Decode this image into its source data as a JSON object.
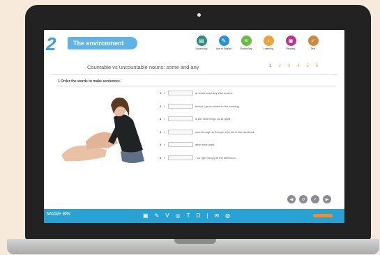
{
  "unit": {
    "number": "2",
    "title": "The environment"
  },
  "nav": [
    {
      "label": "Vocabulary",
      "icon": "book-icon",
      "color": "#2c8d7f",
      "glyph": "▤"
    },
    {
      "label": "Use of English",
      "icon": "speech-bubble-icon",
      "color": "#2c92cf",
      "glyph": "✎"
    },
    {
      "label": "Vocabulary",
      "icon": "list-icon",
      "color": "#6dba45",
      "glyph": "≡"
    },
    {
      "label": "Listening",
      "icon": "ear-icon",
      "color": "#f0a23a",
      "glyph": "♪"
    },
    {
      "label": "Reading",
      "icon": "eye-icon",
      "color": "#b13a8b",
      "glyph": "◉"
    },
    {
      "label": "Test",
      "icon": "check-icon",
      "color": "#c98a3d",
      "glyph": "✓"
    }
  ],
  "lesson_title": "Countable vs uncountable nouns: some and any",
  "pages": [
    "1",
    "2",
    "3",
    "4",
    "5",
    "6"
  ],
  "instruction": "1   Order the words to make sentences.",
  "sentences": [
    {
      "num": "1",
      "pre": "I",
      "post": "at some keep any else noises."
    },
    {
      "num": "2",
      "pre": "I",
      "post": "before I go to school in the morning."
    },
    {
      "num": "3",
      "pre": "I",
      "post": "is the next thing I do at night."
    },
    {
      "num": "4",
      "pre": "I",
      "post": "over through to Europe, find me in the weekend."
    },
    {
      "num": "5",
      "pre": "I",
      "post": "after mine want."
    },
    {
      "num": "6",
      "pre": "I",
      "post": "- so I get hungry in the afternoon."
    }
  ],
  "controls": [
    "◀",
    "↺",
    "✓",
    "▶"
  ],
  "footer": {
    "brand": "Mobile Bits",
    "tools": [
      "▣",
      "✎",
      "V",
      "◎",
      "T",
      "D",
      "|",
      "✉",
      "◍"
    ]
  }
}
